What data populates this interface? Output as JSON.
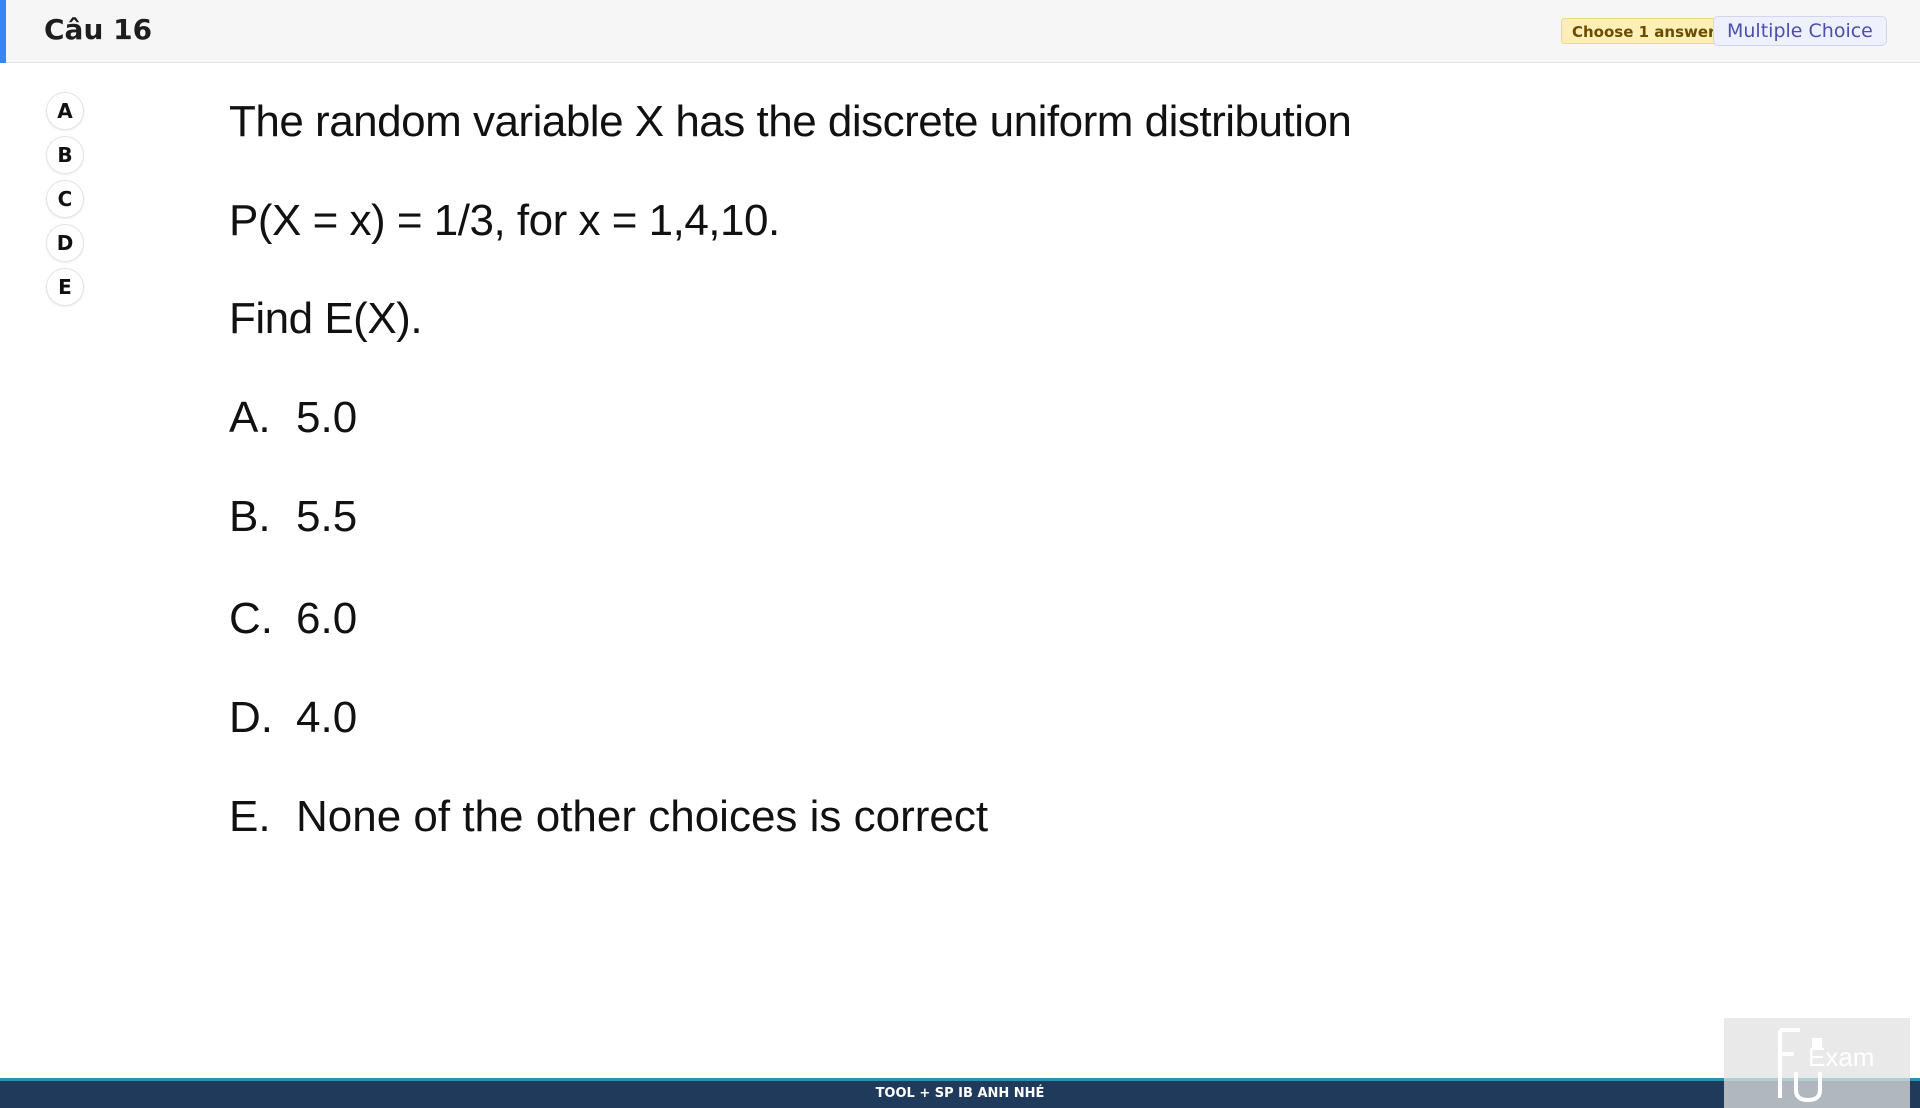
{
  "header": {
    "title": "Câu 16",
    "badge_choose": "Choose 1 answer",
    "badge_type": "Multiple Choice",
    "accent_color": "#3b82f6"
  },
  "options": [
    "A",
    "B",
    "C",
    "D",
    "E"
  ],
  "question": {
    "line1": "The random variable X has the discrete uniform distribution",
    "line2": "P(X = x) = 1/3, for x = 1,4,10.",
    "line3": "Find E(X).",
    "choices": [
      {
        "letter": "A.",
        "text": "5.0"
      },
      {
        "letter": "B.",
        "text": "5.5"
      },
      {
        "letter": "C.",
        "text": "6.0"
      },
      {
        "letter": "D.",
        "text": "4.0"
      },
      {
        "letter": "E.",
        "text": "None of the other choices is correct"
      }
    ]
  },
  "footer": {
    "text": "TOOL + SP IB ANH NHÉ"
  },
  "logo": {
    "text": "FU Exam",
    "icon": "fu-exam-logo"
  }
}
